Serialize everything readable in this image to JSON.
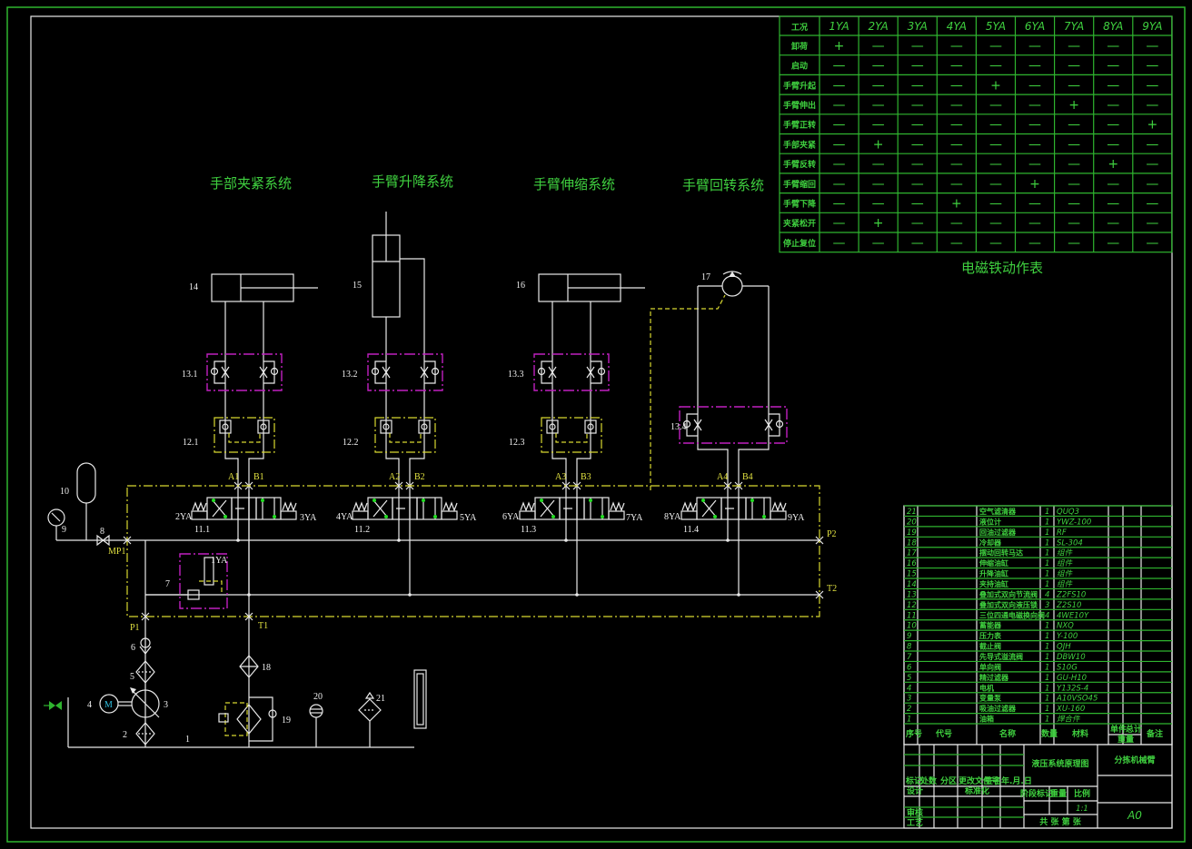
{
  "titles": {
    "clamp_system": "手部夹紧系统",
    "lift_system": "手臂升降系统",
    "extend_system": "手臂伸缩系统",
    "rotate_system": "手臂回转系统",
    "table_caption": "电磁铁动作表"
  },
  "solenoid_table": {
    "header": [
      "工况",
      "1YA",
      "2YA",
      "3YA",
      "4YA",
      "5YA",
      "6YA",
      "7YA",
      "8YA",
      "9YA"
    ],
    "rows": [
      {
        "state": "卸荷",
        "values": [
          "+",
          "—",
          "—",
          "—",
          "—",
          "—",
          "—",
          "—",
          "—"
        ]
      },
      {
        "state": "启动",
        "values": [
          "—",
          "—",
          "—",
          "—",
          "—",
          "—",
          "—",
          "—",
          "—"
        ]
      },
      {
        "state": "手臂升起",
        "values": [
          "—",
          "—",
          "—",
          "—",
          "+",
          "—",
          "—",
          "—",
          "—"
        ]
      },
      {
        "state": "手臂伸出",
        "values": [
          "—",
          "—",
          "—",
          "—",
          "—",
          "—",
          "+",
          "—",
          "—"
        ]
      },
      {
        "state": "手臂正转",
        "values": [
          "—",
          "—",
          "—",
          "—",
          "—",
          "—",
          "—",
          "—",
          "+"
        ]
      },
      {
        "state": "手部夹紧",
        "values": [
          "—",
          "+",
          "—",
          "—",
          "—",
          "—",
          "—",
          "—",
          "—"
        ]
      },
      {
        "state": "手臂反转",
        "values": [
          "—",
          "—",
          "—",
          "—",
          "—",
          "—",
          "—",
          "+",
          "—"
        ]
      },
      {
        "state": "手臂缩回",
        "values": [
          "—",
          "—",
          "—",
          "—",
          "—",
          "+",
          "—",
          "—",
          "—"
        ]
      },
      {
        "state": "手臂下降",
        "values": [
          "—",
          "—",
          "—",
          "+",
          "—",
          "—",
          "—",
          "—",
          "—"
        ]
      },
      {
        "state": "夹紧松开",
        "values": [
          "—",
          "+",
          "—",
          "—",
          "—",
          "—",
          "—",
          "—",
          "—"
        ]
      },
      {
        "state": "停止复位",
        "values": [
          "—",
          "—",
          "—",
          "—",
          "—",
          "—",
          "—",
          "—",
          "—"
        ]
      }
    ]
  },
  "labels": {
    "c14": "14",
    "c15": "15",
    "c16": "16",
    "c17": "17",
    "v13_1": "13.1",
    "v13_2": "13.2",
    "v13_3": "13.3",
    "v13_4": "13.4",
    "v12_1": "12.1",
    "v12_2": "12.2",
    "v12_3": "12.3",
    "v11_1": "11.1",
    "v11_2": "11.2",
    "v11_3": "11.3",
    "v11_4": "11.4",
    "A1": "A1",
    "B1": "B1",
    "A2": "A2",
    "B2": "B2",
    "A3": "A3",
    "B3": "B3",
    "A4": "A4",
    "B4": "B4",
    "ya1": "1YA",
    "ya2": "2YA",
    "ya3": "3YA",
    "ya4": "4YA",
    "ya5": "5YA",
    "ya6": "6YA",
    "ya7": "7YA",
    "ya8": "8YA",
    "ya9": "9YA",
    "MP1": "MP1",
    "P1": "P1",
    "T1": "T1",
    "P2": "P2",
    "T2": "T2",
    "n1": "1",
    "n2": "2",
    "n3": "3",
    "n4": "4",
    "n5": "5",
    "n6": "6",
    "n7": "7",
    "n8": "8",
    "n9": "9",
    "n10": "10",
    "n18": "18",
    "n19": "19",
    "n20": "20",
    "n21": "21",
    "motor": "M"
  },
  "parts_list": {
    "rows": [
      [
        "21",
        "",
        "空气滤清器",
        "1",
        "QUQ3"
      ],
      [
        "20",
        "",
        "液位计",
        "1",
        "YWZ-100"
      ],
      [
        "19",
        "",
        "回油过滤器",
        "1",
        "RF"
      ],
      [
        "18",
        "",
        "冷却器",
        "1",
        "SL-304"
      ],
      [
        "17",
        "",
        "摆动回转马达",
        "1",
        "组件"
      ],
      [
        "16",
        "",
        "伸缩油缸",
        "1",
        "组件"
      ],
      [
        "15",
        "",
        "升降油缸",
        "1",
        "组件"
      ],
      [
        "14",
        "",
        "夹持油缸",
        "1",
        "组件"
      ],
      [
        "13",
        "",
        "叠加式双向节流阀",
        "4",
        "Z2FS10"
      ],
      [
        "12",
        "",
        "叠加式双向液压锁",
        "3",
        "Z2S10"
      ],
      [
        "11",
        "",
        "三位四通电磁换向阀",
        "4",
        "4WE10Y"
      ],
      [
        "10",
        "",
        "蓄能器",
        "1",
        "NXQ"
      ],
      [
        "9",
        "",
        "压力表",
        "1",
        "Y-100"
      ],
      [
        "8",
        "",
        "截止阀",
        "1",
        "QJH"
      ],
      [
        "7",
        "",
        "先导式溢流阀",
        "1",
        "DBW10"
      ],
      [
        "6",
        "",
        "单向阀",
        "1",
        "S10G"
      ],
      [
        "5",
        "",
        "精过滤器",
        "1",
        "GU-H10"
      ],
      [
        "4",
        "",
        "电机",
        "1",
        "Y132S-4"
      ],
      [
        "3",
        "",
        "变量泵",
        "1",
        "A10VSO45"
      ],
      [
        "2",
        "",
        "吸油过滤器",
        "1",
        "XU-160"
      ],
      [
        "1",
        "",
        "油箱",
        "1",
        "焊合件"
      ]
    ],
    "header": {
      "no": "序号",
      "code": "代号",
      "name": "名称",
      "qty": "数量",
      "material": "材料",
      "unit": "单件",
      "total": "总计",
      "weight": "重量",
      "remark": "备注"
    }
  },
  "title_block": {
    "drawing_name": "液压系统原理图",
    "product": "分拣机械臂",
    "mark": "标记",
    "count": "处数",
    "zone": "分区",
    "doc": "更改文件号",
    "sign": "签名",
    "date": "年.月.日",
    "design": "设计",
    "standard": "标准化",
    "review": "审核",
    "process": "工艺",
    "stage": "阶段标记",
    "weight": "重量",
    "scale": "比例",
    "scale_value": "1:1",
    "sheets": "共  张  第  张",
    "size": "A0"
  }
}
